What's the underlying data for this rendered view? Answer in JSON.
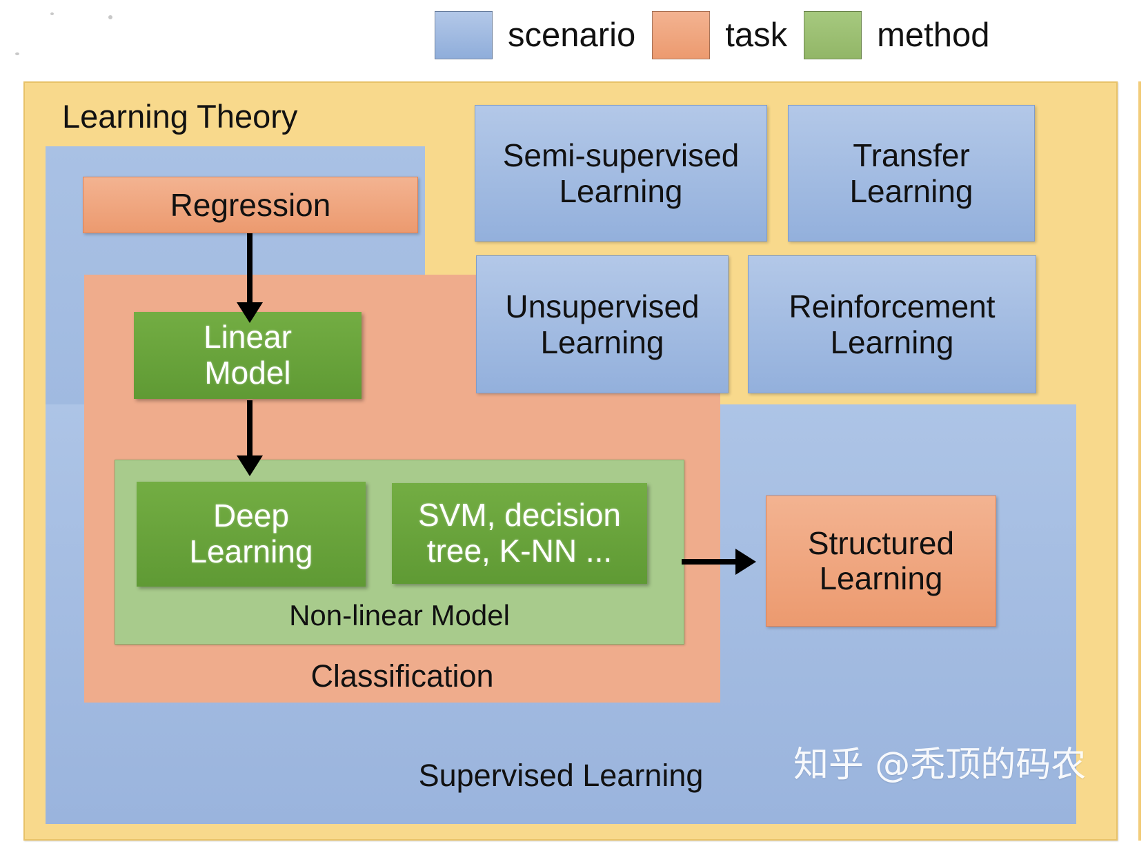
{
  "legend": {
    "items": [
      {
        "label": "scenario",
        "color": "#93b0dc",
        "kind": "scenario"
      },
      {
        "label": "task",
        "color": "#ef9f76",
        "kind": "task"
      },
      {
        "label": "method",
        "color": "#9cbf71",
        "kind": "method"
      }
    ]
  },
  "diagram": {
    "outer": {
      "title": "Learning Theory",
      "color": "#f8d98c",
      "kind": "theory"
    },
    "supervised": {
      "label": "Supervised Learning",
      "color": "#9ab4dd",
      "kind": "scenario"
    },
    "classification": {
      "label": "Classification",
      "color": "#efac8c",
      "kind": "task"
    },
    "nonlinear": {
      "label": "Non-linear Model",
      "color": "#a8cb8c",
      "kind": "method"
    },
    "tasks": {
      "regression": "Regression",
      "structured": "Structured\nLearning"
    },
    "methods": {
      "linear_model": "Linear\nModel",
      "deep_learning": "Deep\nLearning",
      "classical": "SVM, decision\ntree, K-NN ..."
    },
    "scenarios": [
      {
        "label": "Semi-supervised\nLearning"
      },
      {
        "label": "Transfer\nLearning"
      },
      {
        "label": "Unsupervised\nLearning"
      },
      {
        "label": "Reinforcement\nLearning"
      }
    ],
    "arrows": [
      {
        "from": "Regression",
        "to": "Linear Model",
        "direction": "down"
      },
      {
        "from": "Linear Model",
        "to": "Deep Learning",
        "direction": "down"
      },
      {
        "from": "Non-linear Model",
        "to": "Structured Learning",
        "direction": "right"
      }
    ]
  },
  "watermark": {
    "text": "知乎 @秃顶的码农"
  }
}
